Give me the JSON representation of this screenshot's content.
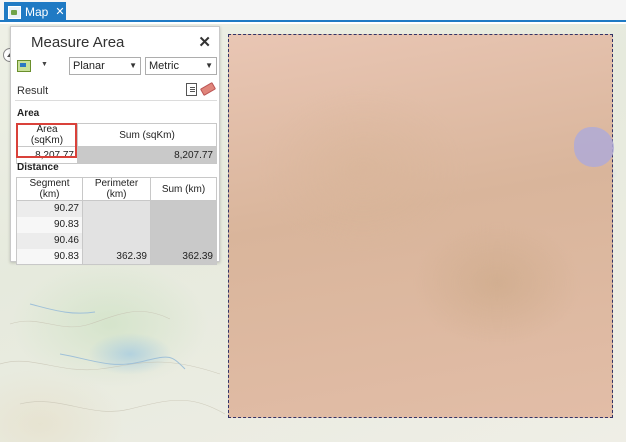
{
  "tab": {
    "label": "Map",
    "close": "✕"
  },
  "pane": {
    "title": "Measure Area",
    "close": "✕",
    "mode_dropdown": "Planar",
    "unit_dropdown": "Metric",
    "result_label": "Result"
  },
  "area": {
    "section_label": "Area",
    "headers": [
      "Area (sqKm)",
      "Sum (sqKm)"
    ],
    "value": "8,207.77",
    "sum": "8,207.77"
  },
  "distance": {
    "section_label": "Distance",
    "headers": [
      "Segment (km)",
      "Perimeter (km)",
      "Sum (km)"
    ],
    "segments": [
      "90.27",
      "90.83",
      "90.46",
      "90.83"
    ],
    "perimeter": "362.39",
    "sum": "362.39"
  },
  "colors": {
    "accent": "#1f7ac4",
    "highlight": "#d9413a",
    "aoi_fill": "#e2bda7"
  },
  "icons": {
    "map_tab": "map-icon",
    "area_tool": "polygon-area-icon",
    "copy": "copy-icon",
    "clear": "eraser-icon"
  }
}
